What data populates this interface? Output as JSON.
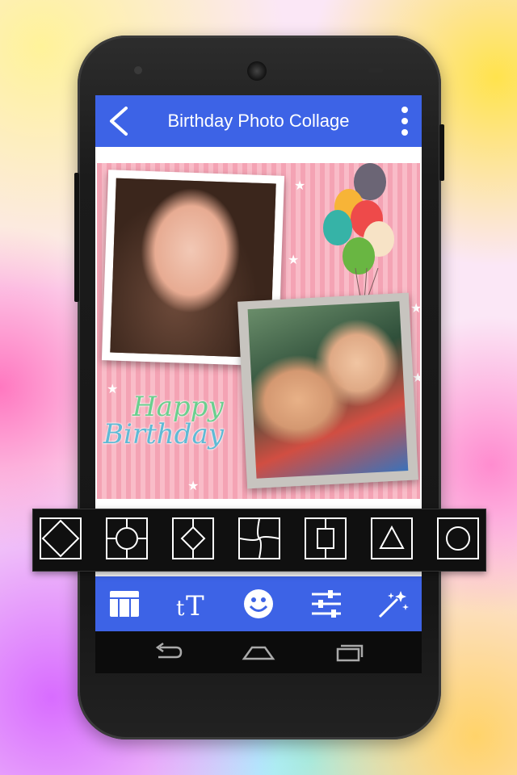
{
  "app_bar": {
    "title": "Birthday Photo Collage",
    "back_icon": "chevron-left-icon",
    "menu_icon": "more-vert-icon",
    "color": "#3d63e6"
  },
  "canvas": {
    "greeting_line1": "Happy",
    "greeting_line2": "Birthday",
    "background_color": "#f4a3b4"
  },
  "shape_toolbar": {
    "items": [
      "diamond-in-square-icon",
      "circle-in-square-icon",
      "diamond-icon",
      "swirl-icon",
      "square-split-icon",
      "triangle-icon",
      "circle-icon"
    ]
  },
  "bottom_tools": {
    "items": [
      "layout-icon",
      "text-icon",
      "sticker-icon",
      "adjust-icon",
      "magic-wand-icon"
    ]
  },
  "nav_bar": {
    "items": [
      "back-arrow-icon",
      "home-icon",
      "recents-icon"
    ]
  }
}
